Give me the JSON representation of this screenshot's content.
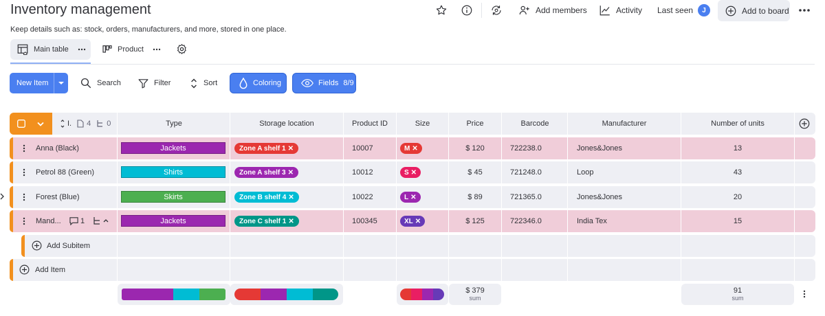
{
  "header": {
    "title": "Inventory management",
    "description": "Keep details such as: stock, orders, manufacturers, and more, stored in one place.",
    "add_members": "Add members",
    "activity": "Activity",
    "last_seen": "Last seen",
    "avatar_initial": "J",
    "add_to_board": "Add to board"
  },
  "views": {
    "main_table": "Main table",
    "product": "Product"
  },
  "toolbar": {
    "new_item": "New Item",
    "search": "Search",
    "filter": "Filter",
    "sort": "Sort",
    "coloring": "Coloring",
    "fields": "Fields",
    "fields_count": "8/9"
  },
  "table": {
    "header": {
      "name_short": "I.",
      "doc_count": "4",
      "sub_count": "0",
      "columns": [
        "Type",
        "Storage location",
        "Product ID",
        "Size",
        "Price",
        "Barcode",
        "Manufacturer",
        "Number of units"
      ]
    },
    "rows": [
      {
        "name": "Anna (Black)",
        "type": "Jackets",
        "location": "Zone A shelf 1",
        "product_id": "10007",
        "size": "M",
        "price": "$ 120",
        "barcode": "722238.0",
        "manufacturer": "Jones&Jones",
        "units": "13"
      },
      {
        "name": "Petrol 88 (Green)",
        "type": "Shirts",
        "location": "Zone A shelf 3",
        "product_id": "10012",
        "size": "S",
        "price": "$ 45",
        "barcode": "721248.0",
        "manufacturer": "Loop",
        "units": "43"
      },
      {
        "name": "Forest (Blue)",
        "type": "Skirts",
        "location": "Zone B shelf 4",
        "product_id": "10022",
        "size": "L",
        "price": "$ 89",
        "barcode": "721365.0",
        "manufacturer": "Jones&Jones",
        "units": "20"
      },
      {
        "name": "Mand...",
        "comment_count": "1",
        "type": "Jackets",
        "location": "Zone C shelf 1",
        "product_id": "100345",
        "size": "XL",
        "price": "$ 125",
        "barcode": "722346.0",
        "manufacturer": "India Tex",
        "units": "15"
      }
    ],
    "add_subitem": "Add Subitem",
    "add_item": "Add Item",
    "summary": {
      "price_sum": "$ 379",
      "price_label": "sum",
      "units_sum": "91",
      "units_label": "sum"
    }
  },
  "colors": {
    "accent": "#4a7ff0",
    "group_bar": "#f2901e",
    "jackets": "#9b27af",
    "shirts": "#00bcd4",
    "skirts": "#4caf50",
    "zone_a1": "#e53935",
    "zone_a3": "#9c27b0",
    "zone_b4": "#00bcd4",
    "zone_c1": "#009688",
    "size_m": "#e53935",
    "size_s": "#e91e63",
    "size_l": "#9c27b0",
    "size_xl": "#673ab7"
  }
}
